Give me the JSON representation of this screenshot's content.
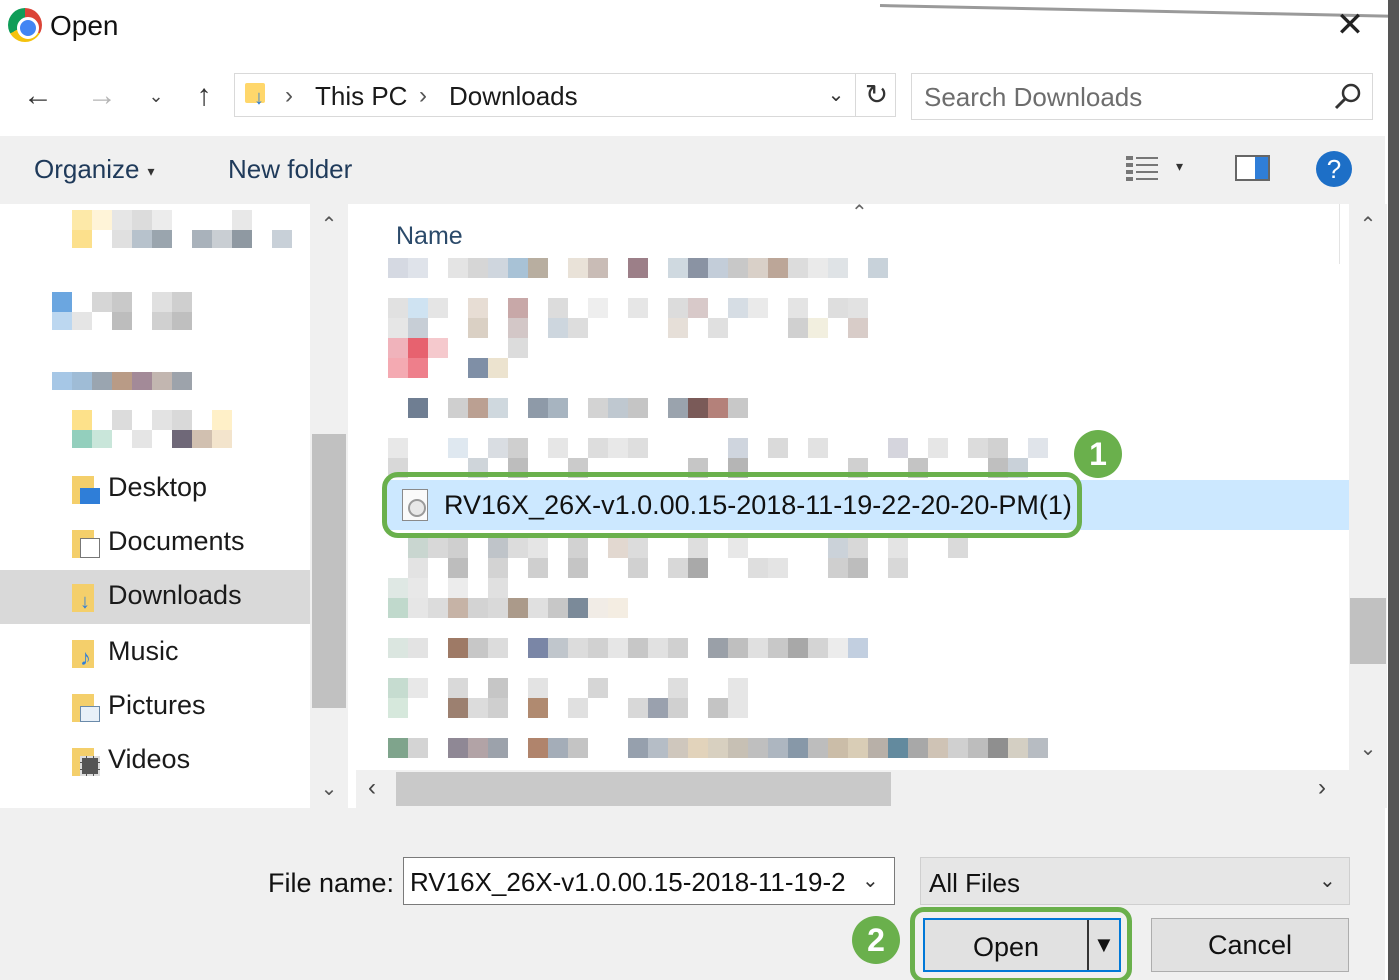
{
  "window": {
    "title": "Open",
    "close_glyph": "✕",
    "app_icon": "chrome-icon"
  },
  "toolbar": {
    "back_glyph": "←",
    "forward_glyph": "→",
    "recent_glyph": "⌄",
    "up_glyph": "↑",
    "breadcrumb": [
      "This PC",
      "Downloads"
    ],
    "breadcrumb_sep": "›",
    "dropdown_glyph": "⌄",
    "refresh_glyph": "↻",
    "search_placeholder": "Search Downloads"
  },
  "commands": {
    "organize": "Organize",
    "organize_caret": "▾",
    "new_folder": "New folder",
    "view_caret": "▾",
    "help_glyph": "?"
  },
  "nav": {
    "items": [
      {
        "label": "Desktop",
        "icon": "desktop-folder-icon"
      },
      {
        "label": "Documents",
        "icon": "documents-folder-icon"
      },
      {
        "label": "Downloads",
        "icon": "downloads-folder-icon",
        "selected": true
      },
      {
        "label": "Music",
        "icon": "music-folder-icon"
      },
      {
        "label": "Pictures",
        "icon": "pictures-folder-icon"
      },
      {
        "label": "Videos",
        "icon": "videos-folder-icon"
      }
    ],
    "up_glyph": "⌃",
    "down_glyph": "⌄"
  },
  "filelist": {
    "column_name": "Name",
    "sort_glyph": "⌃",
    "selected_file": "RV16X_26X-v1.0.00.15-2018-11-19-22-20-20-PM(1)",
    "h_left": "‹",
    "h_right": "›"
  },
  "annotations": {
    "step1": "1",
    "step2": "2",
    "highlight_color": "#6ab04c"
  },
  "footer": {
    "file_name_label": "File name:",
    "file_name_value": "RV16X_26X-v1.0.00.15-2018-11-19-2",
    "file_type": "All Files",
    "dropdown_glyph": "⌄",
    "open_label": "Open",
    "open_split_glyph": "▼",
    "cancel_label": "Cancel"
  },
  "colors": {
    "accent": "#0078d7",
    "selection": "#cce8ff",
    "help": "#1d6fc7"
  }
}
